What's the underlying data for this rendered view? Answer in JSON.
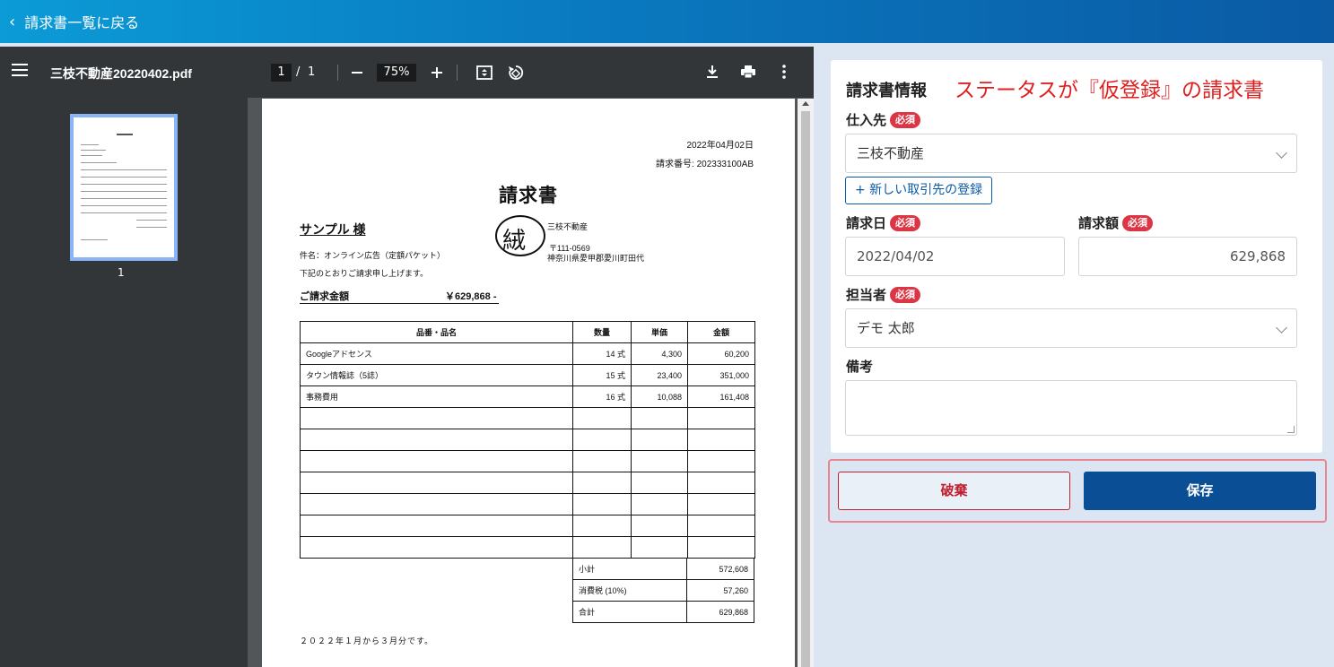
{
  "header": {
    "back_label": "請求書一覧に戻る"
  },
  "viewer": {
    "file_name": "三枝不動産20220402.pdf",
    "current_page": "1",
    "page_separator": "/",
    "total_pages": "1",
    "zoom": "75%",
    "thumbnail_label": "1"
  },
  "invoice": {
    "date": "2022年04月02日",
    "number": "請求番号: 202333100AB",
    "heading": "請求書",
    "recipient": "サンプル 様",
    "subject": "件名：オンライン広告（定額パケット）",
    "note": "下記のとおりご請求申し上げます。",
    "amount_label": "ご請求金額",
    "amount_value": "￥629,868 -",
    "issuer_name": "三枝不動産",
    "issuer_zip": "〒111-0569",
    "issuer_address": "神奈川県愛甲郡愛川町田代",
    "stamp_text": "絨",
    "columns": [
      "品番・品名",
      "数量",
      "単価",
      "金額"
    ],
    "items": [
      {
        "name": "Googleアドセンス",
        "qty": "14 式",
        "price": "4,300",
        "amount": "60,200"
      },
      {
        "name": "タウン情報誌（5誌）",
        "qty": "15 式",
        "price": "23,400",
        "amount": "351,000"
      },
      {
        "name": "事務費用",
        "qty": "16 式",
        "price": "10,088",
        "amount": "161,408"
      }
    ],
    "totals": [
      {
        "label": "小計",
        "value": "572,608"
      },
      {
        "label": "消費税 (10%)",
        "value": "57,260"
      },
      {
        "label": "合計",
        "value": "629,868"
      }
    ],
    "footnote": "２０２２年１月から３月分です。"
  },
  "form": {
    "title": "請求書情報",
    "annotation": "ステータスが『仮登録』の請求書",
    "required_badge": "必須",
    "vendor_label": "仕入先",
    "vendor_value": "三枝不動産",
    "new_vendor_button": "+ 新しい取引先の登録",
    "date_label": "請求日",
    "date_value": "2022/04/02",
    "amount_label": "請求額",
    "amount_value": "629,868",
    "assignee_label": "担当者",
    "assignee_value": "デモ 太郎",
    "memo_label": "備考",
    "memo_value": ""
  },
  "actions": {
    "discard_label": "破棄",
    "save_label": "保存"
  },
  "colors": {
    "accent": "#0a4e96",
    "danger": "#dc3545",
    "annotation": "#e02020"
  }
}
